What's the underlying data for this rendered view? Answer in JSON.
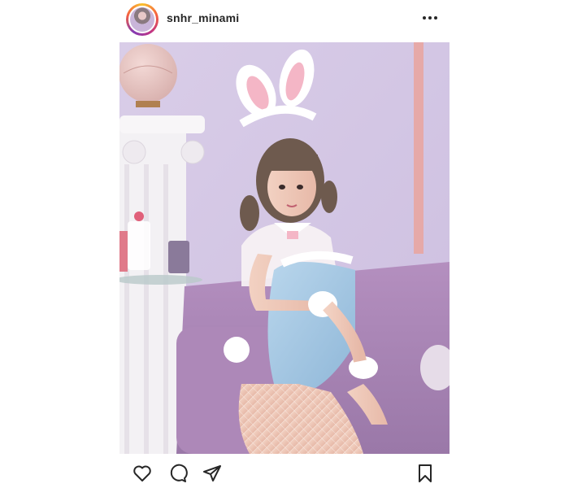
{
  "post": {
    "username": "snhr_minami",
    "icons": {
      "avatar": "profile-avatar",
      "more": "more-options-icon",
      "like": "heart-icon",
      "comment": "comment-icon",
      "share": "paper-plane-icon",
      "save": "bookmark-icon"
    },
    "colors": {
      "text": "#262626",
      "icon_stroke": "#262626",
      "story_ring": [
        "#f9c12e",
        "#f56040",
        "#c13584",
        "#833ab4"
      ]
    }
  }
}
